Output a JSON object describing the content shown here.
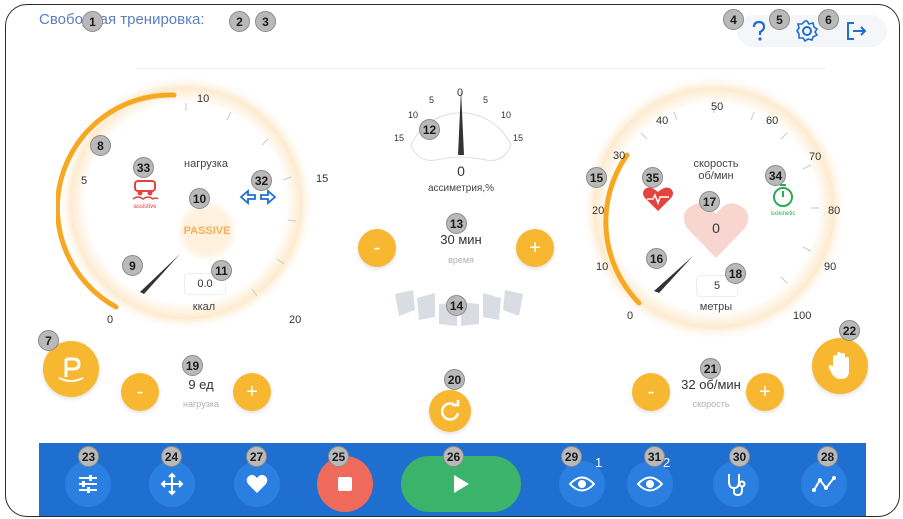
{
  "header": {
    "title": "Свободная тренировка:",
    "help_icon": "question-icon",
    "settings_icon": "gear-icon",
    "exit_icon": "logout-icon"
  },
  "left_gauge": {
    "ticks": [
      "0",
      "5",
      "10",
      "15",
      "20"
    ],
    "label": "нагрузка",
    "mode": "PASSIVE",
    "assistive_label": "assistive",
    "kcal_value": "0.0",
    "kcal_label": "ккал",
    "value_fraction": 0.32,
    "colors": {
      "arc": "#f7a823",
      "glow": "#fde8c6",
      "assistive": "#e5433d",
      "arrows": "#1f6fd1"
    }
  },
  "asymmetry": {
    "ticks_left": [
      "15",
      "10",
      "5"
    ],
    "zero": "0",
    "ticks_right": [
      "5",
      "10",
      "15"
    ],
    "value": "0",
    "label": "ассиметрия,%"
  },
  "time": {
    "value": "30 мин",
    "caption": "время",
    "minus": "-",
    "plus": "+"
  },
  "right_gauge": {
    "ticks": [
      "0",
      "10",
      "20",
      "30",
      "40",
      "50",
      "60",
      "70",
      "80",
      "90",
      "100"
    ],
    "label_line1": "скорость",
    "label_line2": "об/мин",
    "heart_value": "0",
    "meters_value": "5",
    "meters_label": "метры",
    "isokinetic_label": "isokinetic",
    "value_fraction": 0.12,
    "colors": {
      "arc": "#f7a823",
      "heart": "#f9d5cf",
      "pulse": "#e5433d",
      "isokinetic": "#2eaa55"
    }
  },
  "load_control": {
    "value": "9 ед",
    "caption": "нагрузка",
    "minus": "-",
    "plus": "+"
  },
  "speed_control": {
    "value": "32 об/мин",
    "caption": "скорость",
    "minus": "-",
    "plus": "+"
  },
  "bottom_bar": {
    "buttons": [
      "sliders-icon",
      "move-icon",
      "heart-icon",
      "stop-icon",
      "play-icon",
      "eye-1-icon",
      "eye-2-icon",
      "stethoscope-icon",
      "graph-icon"
    ],
    "eye1_sup": "1",
    "eye2_sup": "2",
    "colors": {
      "bar": "#1f6fd1",
      "stop": "#f06a5b",
      "play": "#3bb36a"
    }
  },
  "badges": [
    "1",
    "2",
    "3",
    "4",
    "5",
    "6",
    "7",
    "8",
    "9",
    "10",
    "11",
    "12",
    "13",
    "14",
    "15",
    "16",
    "17",
    "18",
    "19",
    "20",
    "21",
    "22",
    "23",
    "24",
    "25",
    "26",
    "27",
    "28",
    "29",
    "30",
    "31",
    "32",
    "33",
    "34",
    "35"
  ]
}
